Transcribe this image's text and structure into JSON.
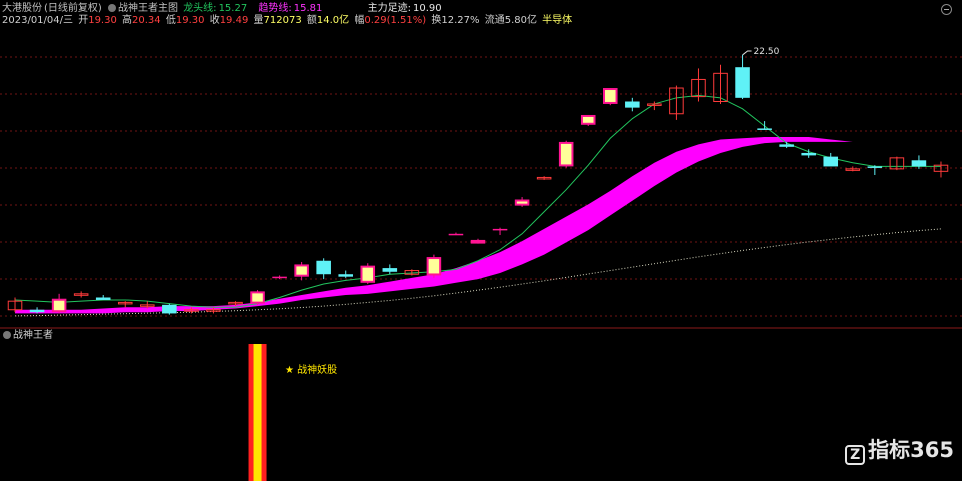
{
  "header": {
    "stock_name": "大港股份",
    "period_mode": "(日线前复权)",
    "indicator_name": "战神王者主图",
    "dragon_label": "龙头线:",
    "dragon_value": "15.27",
    "trend_label": "趋势线:",
    "trend_value": "15.81",
    "main_trace_label": "主力足迹:",
    "main_trace_value": "10.90"
  },
  "info_bar": {
    "date": "2023/01/04/三",
    "open_label": "开",
    "open": "19.30",
    "high_label": "高",
    "high": "20.34",
    "low_label": "低",
    "low": "19.30",
    "close_label": "收",
    "close": "19.49",
    "volume_label": "量",
    "volume": "712073",
    "amount_label": "额",
    "amount": "14.0亿",
    "change_label": "幅",
    "change": "0.29(1.51%)",
    "turnover_label": "换",
    "turnover": "12.27%",
    "float_label": "流通",
    "float": "5.80亿",
    "sector": "半导体"
  },
  "sub_panel": {
    "title": "战神王者",
    "signal_label": "★ 战神妖股"
  },
  "watermark": {
    "text": "指标365",
    "logo": "Z"
  },
  "colors": {
    "up_filled": "#ff1493",
    "up_body_inner": "#ffff99",
    "up_hollow": "#ff3b3b",
    "down": "#5ff1f6",
    "dragon": "#22c55e",
    "band": "#ff00ff",
    "dotted": "#d8d8c0",
    "grid": "#8b1a1a",
    "signal_outer": "#ff2020",
    "signal_inner": "#ffe600"
  },
  "chart_data": {
    "type": "candlestick",
    "annotations": [
      {
        "text": "22.50",
        "kind": "high-marker"
      }
    ],
    "y_range": [
      11.6,
      23.6
    ],
    "candles": [
      {
        "o": 12.1,
        "h": 12.6,
        "l": 12.0,
        "c": 12.45,
        "style": "hollow"
      },
      {
        "o": 12.1,
        "h": 12.2,
        "l": 11.95,
        "c": 12.0,
        "style": "down"
      },
      {
        "o": 12.0,
        "h": 12.75,
        "l": 11.95,
        "c": 12.55,
        "style": "filled"
      },
      {
        "o": 12.7,
        "h": 12.85,
        "l": 12.6,
        "c": 12.75,
        "style": "hollow"
      },
      {
        "o": 12.6,
        "h": 12.7,
        "l": 12.5,
        "c": 12.5,
        "style": "down"
      },
      {
        "o": 12.35,
        "h": 12.45,
        "l": 12.2,
        "c": 12.4,
        "style": "hollow"
      },
      {
        "o": 12.3,
        "h": 12.45,
        "l": 12.15,
        "c": 12.3,
        "style": "hollow"
      },
      {
        "o": 12.3,
        "h": 12.35,
        "l": 11.9,
        "c": 11.95,
        "style": "down"
      },
      {
        "o": 12.1,
        "h": 12.2,
        "l": 11.95,
        "c": 12.1,
        "style": "hollow"
      },
      {
        "o": 12.05,
        "h": 12.2,
        "l": 11.95,
        "c": 12.1,
        "style": "hollow"
      },
      {
        "o": 12.35,
        "h": 12.45,
        "l": 12.25,
        "c": 12.4,
        "style": "hollow"
      },
      {
        "o": 12.35,
        "h": 12.9,
        "l": 12.3,
        "c": 12.85,
        "style": "filled"
      },
      {
        "o": 13.45,
        "h": 13.5,
        "l": 13.35,
        "c": 13.45,
        "style": "filled"
      },
      {
        "o": 13.45,
        "h": 14.05,
        "l": 13.3,
        "c": 13.95,
        "style": "filled"
      },
      {
        "o": 14.1,
        "h": 14.2,
        "l": 13.35,
        "c": 13.55,
        "style": "down"
      },
      {
        "o": 13.55,
        "h": 13.7,
        "l": 13.4,
        "c": 13.45,
        "style": "down"
      },
      {
        "o": 13.2,
        "h": 14.0,
        "l": 13.15,
        "c": 13.9,
        "style": "filled"
      },
      {
        "o": 13.8,
        "h": 13.95,
        "l": 13.55,
        "c": 13.65,
        "style": "down"
      },
      {
        "o": 13.55,
        "h": 13.75,
        "l": 13.5,
        "c": 13.7,
        "style": "hollow"
      },
      {
        "o": 13.5,
        "h": 14.35,
        "l": 13.4,
        "c": 14.25,
        "style": "filled"
      },
      {
        "o": 15.2,
        "h": 15.25,
        "l": 15.15,
        "c": 15.2,
        "style": "filled"
      },
      {
        "o": 14.8,
        "h": 15.0,
        "l": 14.8,
        "c": 14.95,
        "style": "filled"
      },
      {
        "o": 15.35,
        "h": 15.45,
        "l": 15.15,
        "c": 15.4,
        "style": "filled"
      },
      {
        "o": 16.35,
        "h": 16.7,
        "l": 16.3,
        "c": 16.6,
        "style": "filled"
      },
      {
        "o": 17.5,
        "h": 17.55,
        "l": 17.4,
        "c": 17.5,
        "style": "hollow"
      },
      {
        "o": 17.95,
        "h": 19.0,
        "l": 17.9,
        "c": 18.95,
        "style": "filled"
      },
      {
        "o": 19.65,
        "h": 20.05,
        "l": 19.6,
        "c": 20.05,
        "style": "filled"
      },
      {
        "o": 20.5,
        "h": 21.15,
        "l": 20.45,
        "c": 21.15,
        "style": "filled"
      },
      {
        "o": 20.6,
        "h": 20.75,
        "l": 20.2,
        "c": 20.35,
        "style": "down"
      },
      {
        "o": 20.45,
        "h": 20.6,
        "l": 20.25,
        "c": 20.5,
        "style": "hollow"
      },
      {
        "o": 20.1,
        "h": 21.25,
        "l": 19.85,
        "c": 21.15,
        "style": "hollow"
      },
      {
        "o": 20.8,
        "h": 21.95,
        "l": 20.6,
        "c": 21.5,
        "style": "hollow"
      },
      {
        "o": 20.6,
        "h": 22.1,
        "l": 20.5,
        "c": 21.75,
        "style": "hollow"
      },
      {
        "o": 22.0,
        "h": 22.5,
        "l": 20.7,
        "c": 20.75,
        "style": "down"
      },
      {
        "o": 19.5,
        "h": 19.8,
        "l": 19.45,
        "c": 19.5,
        "style": "down"
      },
      {
        "o": 18.75,
        "h": 18.95,
        "l": 18.7,
        "c": 18.85,
        "style": "down"
      },
      {
        "o": 18.5,
        "h": 18.65,
        "l": 18.3,
        "c": 18.4,
        "style": "down"
      },
      {
        "o": 18.35,
        "h": 18.5,
        "l": 18.0,
        "c": 17.95,
        "style": "down"
      },
      {
        "o": 17.85,
        "h": 17.95,
        "l": 17.75,
        "c": 17.85,
        "style": "hollow"
      },
      {
        "o": 17.9,
        "h": 18.0,
        "l": 17.6,
        "c": 17.95,
        "style": "down"
      },
      {
        "o": 17.85,
        "h": 18.35,
        "l": 17.8,
        "c": 18.3,
        "style": "hollow"
      },
      {
        "o": 18.2,
        "h": 18.4,
        "l": 17.85,
        "c": 17.95,
        "style": "down"
      },
      {
        "o": 17.75,
        "h": 18.15,
        "l": 17.5,
        "c": 18.0,
        "style": "hollow"
      }
    ],
    "dragon_line": [
      12.5,
      12.45,
      12.4,
      12.45,
      12.5,
      12.5,
      12.45,
      12.35,
      12.25,
      12.2,
      12.2,
      12.35,
      12.6,
      12.9,
      13.15,
      13.3,
      13.4,
      13.55,
      13.6,
      13.65,
      13.75,
      14.1,
      14.55,
      15.2,
      16.1,
      17.0,
      18.0,
      19.1,
      19.9,
      20.5,
      20.75,
      20.85,
      20.75,
      20.3,
      19.6,
      18.9,
      18.55,
      18.3,
      18.1,
      17.95,
      17.95,
      17.95,
      17.95
    ],
    "band_upper": [
      12.1,
      12.1,
      12.1,
      12.1,
      12.15,
      12.2,
      12.2,
      12.25,
      12.25,
      12.25,
      12.3,
      12.4,
      12.55,
      12.7,
      12.85,
      13.0,
      13.1,
      13.25,
      13.4,
      13.55,
      13.8,
      14.1,
      14.45,
      14.9,
      15.4,
      15.9,
      16.4,
      16.95,
      17.55,
      18.1,
      18.55,
      18.85,
      19.05,
      19.1,
      19.15,
      19.15,
      19.15,
      19.05,
      18.95,
      18.85,
      18.75,
      18.65,
      18.55
    ],
    "band_lower": [
      11.95,
      11.95,
      11.95,
      11.95,
      11.95,
      12.0,
      12.0,
      12.05,
      12.05,
      12.1,
      12.15,
      12.25,
      12.35,
      12.5,
      12.6,
      12.7,
      12.75,
      12.85,
      12.95,
      13.05,
      13.2,
      13.35,
      13.6,
      13.95,
      14.35,
      14.85,
      15.35,
      15.95,
      16.55,
      17.15,
      17.7,
      18.15,
      18.5,
      18.75,
      18.9,
      18.95,
      18.95,
      18.95,
      18.95,
      18.85,
      18.75,
      18.65,
      18.55
    ],
    "dotted_line": [
      11.85,
      11.86,
      11.88,
      11.9,
      11.92,
      11.94,
      11.96,
      11.98,
      12.0,
      12.03,
      12.06,
      12.1,
      12.14,
      12.19,
      12.25,
      12.32,
      12.4,
      12.48,
      12.57,
      12.67,
      12.78,
      12.9,
      13.02,
      13.15,
      13.28,
      13.42,
      13.56,
      13.7,
      13.84,
      13.98,
      14.12,
      14.26,
      14.39,
      14.52,
      14.64,
      14.76,
      14.87,
      14.97,
      15.07,
      15.16,
      15.25,
      15.33,
      15.4
    ],
    "signal_bar_index": 11
  }
}
